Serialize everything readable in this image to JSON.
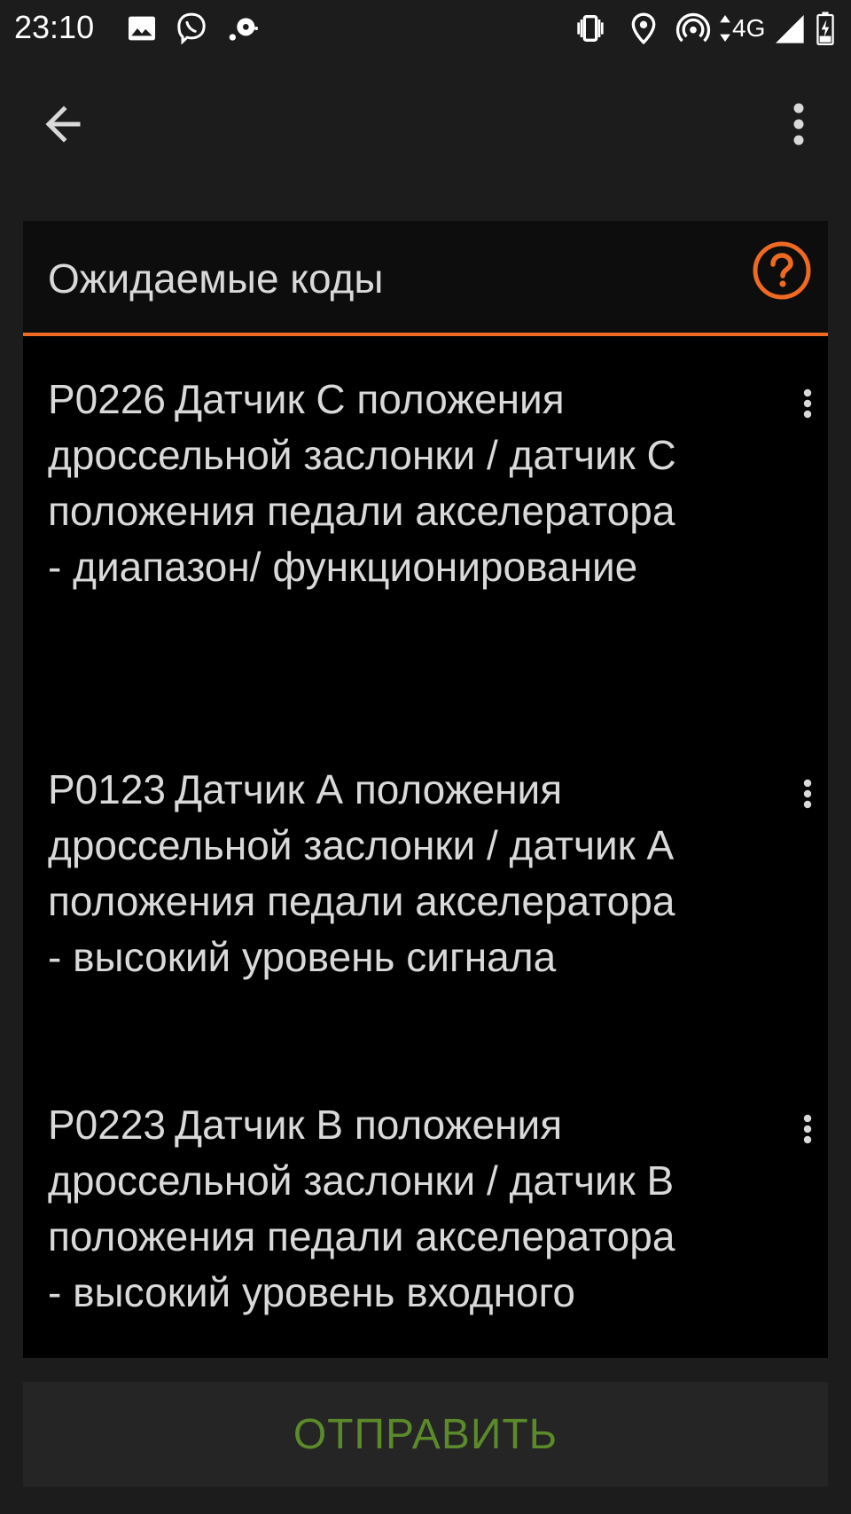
{
  "status_bar": {
    "time": "23:10",
    "network": "4G",
    "left_icons": [
      "image-icon",
      "viber-icon",
      "cast-icon"
    ],
    "right_icons": [
      "vibrate-icon",
      "location-icon",
      "hotspot-icon",
      "signal-icon",
      "battery-charging-icon"
    ]
  },
  "app_bar": {
    "back_icon": "arrow-left-icon",
    "menu_icon": "more-vert-icon"
  },
  "dialog": {
    "title": "Ожидаемые коды",
    "help_icon": "help-circle-icon",
    "accent_color": "#ee6a22",
    "codes": [
      {
        "code": "P0226",
        "description": "Датчик С положения дроссельной заслонки / датчик С положения педали акселератора - диапазон/ функционирование"
      },
      {
        "code": "P0123",
        "description": "Датчик А положения дроссельной заслонки / датчик А положения педали акселератора - высокий уровень сигнала"
      },
      {
        "code": "P0223",
        "description": "Датчик В положения дроссельной заслонки / датчик В положения педали акселератора - высокий уровень входного"
      }
    ]
  },
  "footer": {
    "send_label": "ОТПРАВИТЬ",
    "send_color": "#5c8a2a"
  }
}
